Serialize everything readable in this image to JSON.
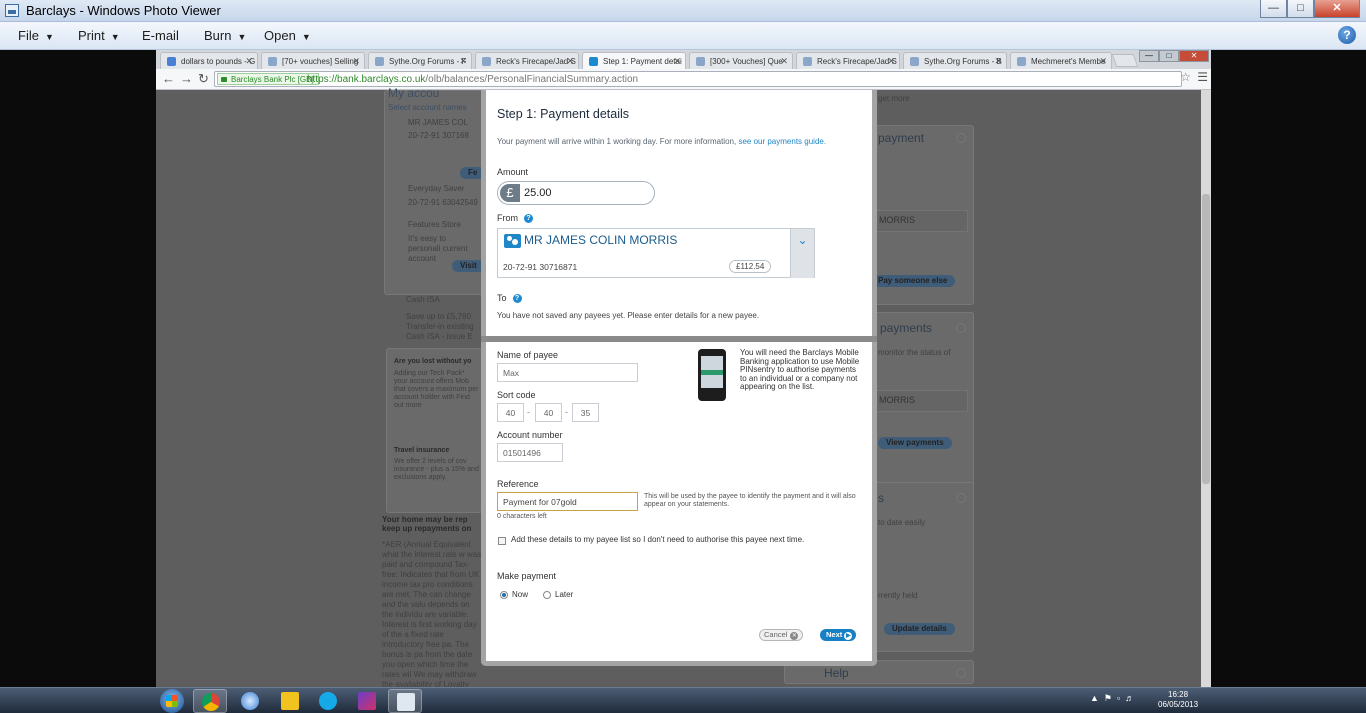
{
  "window": {
    "title": "Barclays - Windows Photo Viewer",
    "menu": [
      "File",
      "Print",
      "E-mail",
      "Burn",
      "Open"
    ]
  },
  "browser": {
    "tabs": [
      {
        "label": "dollars to pounds - G"
      },
      {
        "label": "[70+ vouches] Selling"
      },
      {
        "label": "Sythe.Org Forums - F"
      },
      {
        "label": "Reck's Firecape/Jad S"
      },
      {
        "label": "Step 1: Payment detai"
      },
      {
        "label": "[300+ Vouches] Que"
      },
      {
        "label": "Reck's Firecape/Jad S"
      },
      {
        "label": "Sythe.Org Forums - B"
      },
      {
        "label": "Mechmeret's Membe"
      }
    ],
    "ev_badge": "Barclays Bank Plc [GB]",
    "url_host": "https://bank.barclays.co.uk",
    "url_path": "/olb/balances/PersonalFinancialSummary.action"
  },
  "background_page": {
    "left": {
      "account_name": "MR JAMES COL",
      "account_num": "20-72-91 307168",
      "everyday_saver": "Everyday Saver",
      "everyday_num": "20-72-91 63042549",
      "features_store": "Features Store",
      "features_desc": "It's easy to personali current account",
      "visit_btn": "Visit",
      "cash_isa": "Cash ISA",
      "cash_isa_desc": "Save up to £5,760 Transfer-in existing Cash ISA - issue E",
      "tech_q": "Are you lost without yo",
      "tech_desc": "Adding our Tech Pack* your account offers Mob that covers a maximum per account holder with Find out more",
      "travel": "Travel insurance",
      "travel_desc": "We offer 2 levels of cov insurance - plus a 15% and exclusions apply.",
      "home_q": "Your home may be rep keep up repayments on",
      "aer_desc": "*AER (Annual Equivalent what the interest rate w was paid and compound Tax-free: Indicates that from UK income tax pro conditions are met. The can change and the valu depends on the individu are variable. Interest is first working day of the a fixed rate introductory free pa. The bonus is pa from the date you open which time the rates wil We may withdraw the availability of Loyalty Reward ISA, or withdraw or change the bonus offer, at any time without notice. This"
    },
    "right": {
      "get_more": "get more",
      "payment_head": "payment",
      "morris_1": "MORRIS",
      "pay_someone": "Pay someone else",
      "payments_head": "payments",
      "monitor": "monitor the status of",
      "morris_2": "MORRIS",
      "view_payments": "View payments",
      "s_head": "s",
      "to_date": "to date easily",
      "held": "rrently held",
      "update_details": "Update details",
      "help": "Help"
    }
  },
  "modal": {
    "title": "Step 1: Payment details",
    "note": "Your payment will arrive within 1 working day. For more information,",
    "note_link": "see our payments guide.",
    "amount_label": "Amount",
    "currency_symbol": "£",
    "amount_value": "25.00",
    "from_label": "From",
    "from_account_name": "MR JAMES COLIN MORRIS",
    "from_account_number": "20-72-91 30716871",
    "from_balance": "£112.54",
    "to_label": "To",
    "to_note": "You have not saved any payees yet. Please enter details for a new payee.",
    "payee_label": "Name of payee",
    "payee_value": "Max",
    "sort_label": "Sort code",
    "sort_1": "40",
    "sort_2": "40",
    "sort_3": "35",
    "account_label": "Account number",
    "account_value": "01501496",
    "reference_label": "Reference",
    "reference_value": "Payment for 07gold",
    "char_count": "0 characters left",
    "reference_help": "This will be used by the payee to identify the payment and it will also appear on your statements.",
    "mobile_note": "You will need the Barclays Mobile Banking application to use Mobile PINsentry to authorise payments to an individual or a company not appearing on the list.",
    "save_payee_label": "Add these details to my payee list so I don't need to authorise this payee next time.",
    "make_payment_label": "Make payment",
    "now_label": "Now",
    "later_label": "Later",
    "cancel_label": "Cancel",
    "next_label": "Next"
  },
  "taskbar": {
    "time": "16:28",
    "date": "06/05/2013"
  }
}
